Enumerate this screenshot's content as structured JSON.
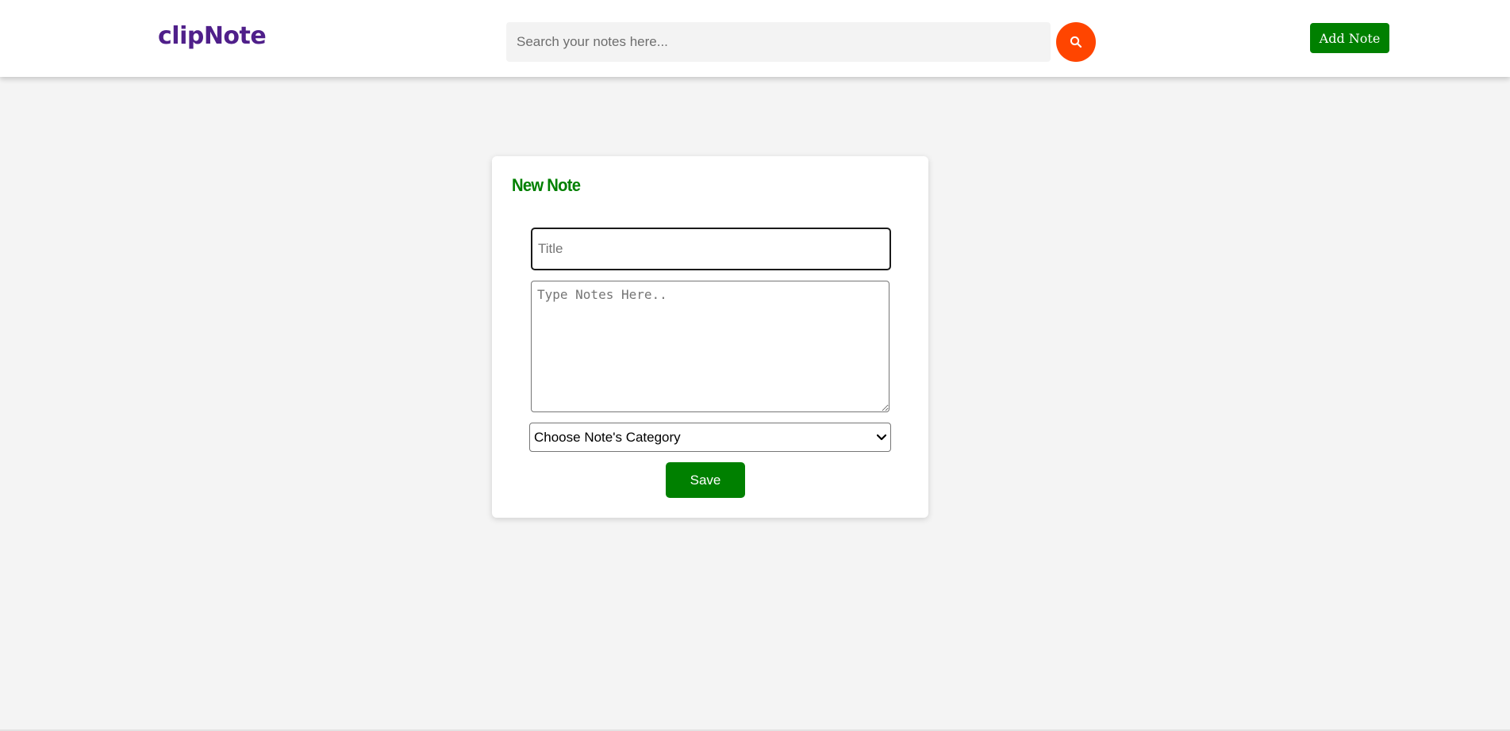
{
  "navbar": {
    "logo": "clipNote",
    "search": {
      "placeholder": "Search your notes here...",
      "value": "",
      "button_icon": "search-icon",
      "button_color": "#ff4500"
    },
    "add_note_label": "Add Note",
    "add_note_color": "#008000"
  },
  "form": {
    "heading": "New Note",
    "heading_color": "#008000",
    "title_placeholder": "Title",
    "title_value": "",
    "notes_placeholder": "Type Notes Here..",
    "notes_value": "",
    "category_selected": "Choose Note's Category",
    "category_icon": "chevron-down-icon",
    "save_label": "Save",
    "save_color": "#008000"
  },
  "colors": {
    "logo": "#4f1f8a",
    "background": "#f4f4f4"
  }
}
